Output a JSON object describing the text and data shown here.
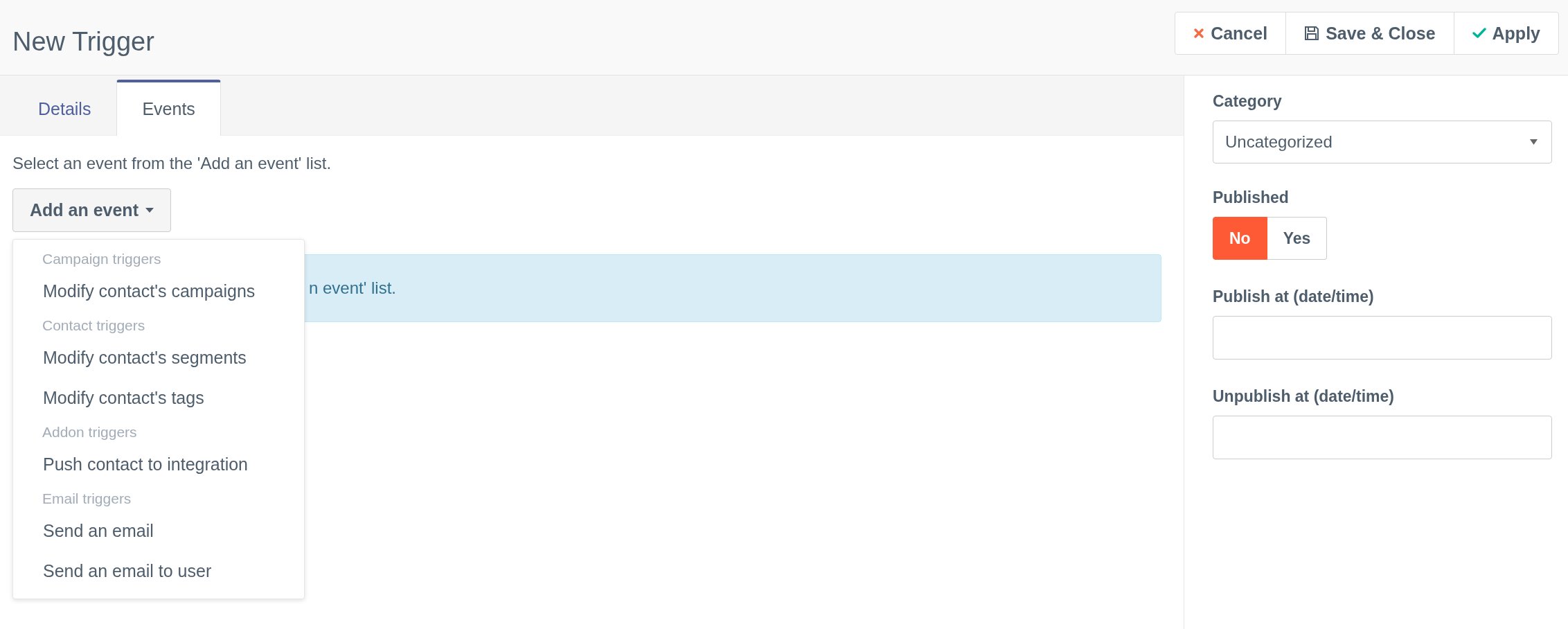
{
  "header": {
    "title": "New Trigger",
    "buttons": [
      {
        "kind": "cancel",
        "label": "Cancel"
      },
      {
        "kind": "save",
        "label": "Save & Close"
      },
      {
        "kind": "apply",
        "label": "Apply"
      }
    ]
  },
  "tabs": [
    {
      "label": "Details",
      "selected": false
    },
    {
      "label": "Events",
      "selected": true
    }
  ],
  "events": {
    "hint": "Select an event from the 'Add an event' list.",
    "add_button": "Add an event",
    "alert": "n event' list.",
    "menu": [
      {
        "kind": "header",
        "label": "Campaign triggers"
      },
      {
        "kind": "item",
        "label": "Modify contact's campaigns"
      },
      {
        "kind": "header",
        "label": "Contact triggers"
      },
      {
        "kind": "item",
        "label": "Modify contact's segments"
      },
      {
        "kind": "item",
        "label": "Modify contact's tags"
      },
      {
        "kind": "header",
        "label": "Addon triggers"
      },
      {
        "kind": "item",
        "label": "Push contact to integration"
      },
      {
        "kind": "header",
        "label": "Email triggers"
      },
      {
        "kind": "item",
        "label": "Send an email"
      },
      {
        "kind": "item",
        "label": "Send an email to user"
      }
    ]
  },
  "sidebar": {
    "category": {
      "label": "Category",
      "value": "Uncategorized"
    },
    "published": {
      "label": "Published",
      "options": [
        {
          "label": "No",
          "selected": true
        },
        {
          "label": "Yes",
          "selected": false
        }
      ]
    },
    "publish_up": {
      "label": "Publish at (date/time)"
    },
    "publish_down": {
      "label": "Unpublish at (date/time)"
    }
  }
}
